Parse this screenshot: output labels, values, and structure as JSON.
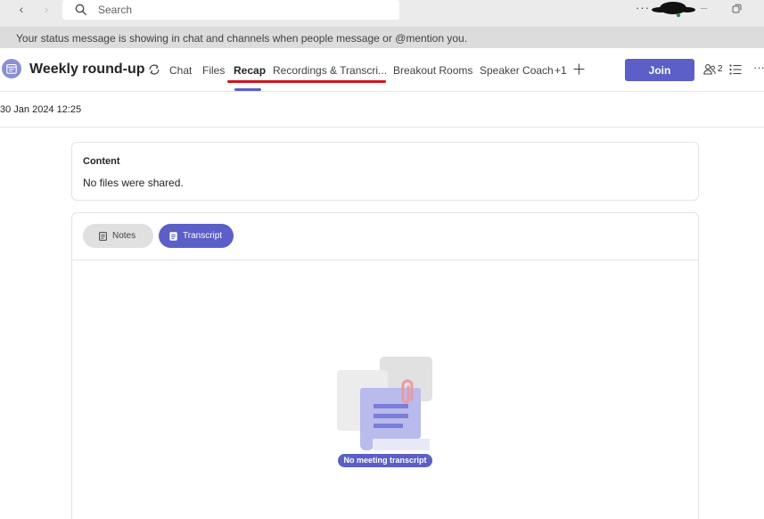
{
  "titlebar": {
    "search_placeholder": "Search",
    "more_label": "···",
    "minimize_label": "–"
  },
  "status_banner": {
    "text": "Your status message is showing in chat and channels when people message or @mention you."
  },
  "meeting": {
    "title": "Weekly round-up",
    "tabs": [
      {
        "label": "Chat",
        "active": false
      },
      {
        "label": "Files",
        "active": false
      },
      {
        "label": "Recap",
        "active": true
      },
      {
        "label": "Recordings & Transcri...",
        "active": false
      },
      {
        "label": "Breakout Rooms",
        "active": false
      },
      {
        "label": "Speaker Coach",
        "active": false
      },
      {
        "label": "+1",
        "active": false
      }
    ],
    "join_label": "Join",
    "participant_count": "2",
    "more_label": "···"
  },
  "date": "30 Jan 2024 12:25",
  "content": {
    "title": "Content",
    "subtitle": "No files were shared."
  },
  "notes_tabs": [
    {
      "label": "Notes",
      "icon": "notes-icon",
      "active": false
    },
    {
      "label": "Transcript",
      "icon": "transcript-icon",
      "active": true
    }
  ],
  "empty_state": {
    "label": "No meeting transcript"
  },
  "colors": {
    "accent": "#5b5fc7",
    "annotation": "#d1131c"
  }
}
